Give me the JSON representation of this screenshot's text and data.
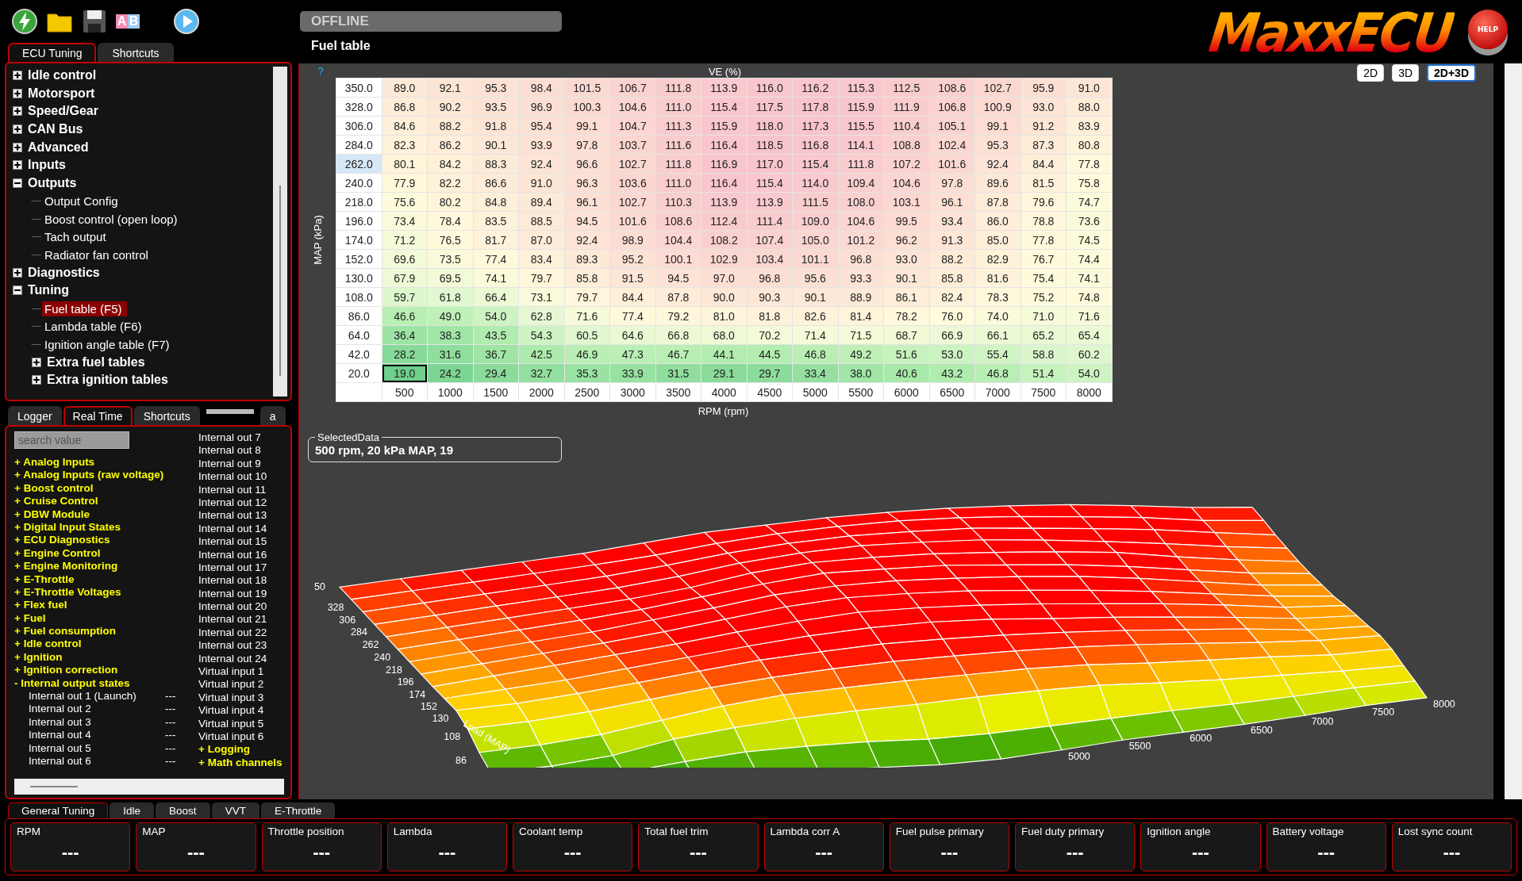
{
  "toolbar": [
    {
      "kind": "connect"
    },
    {
      "kind": "open"
    },
    {
      "kind": "save"
    },
    {
      "kind": "compare",
      "letters": [
        "A",
        "B"
      ]
    },
    {
      "kind": "play"
    }
  ],
  "status_field": {
    "value": "OFFLINE"
  },
  "page_title": "Fuel table",
  "logo": {
    "text": "MaxxECU"
  },
  "help_button": {
    "label": "HELP"
  },
  "tree_tabs": [
    {
      "label": "ECU Tuning",
      "selected": true
    },
    {
      "label": "Shortcuts",
      "selected": false
    }
  ],
  "tree": {
    "items": [
      {
        "label": "Idle control",
        "kind": "group",
        "expanded": false,
        "selected": false
      },
      {
        "label": "Motorsport",
        "kind": "group",
        "expanded": false,
        "selected": false
      },
      {
        "label": "Speed/Gear",
        "kind": "group",
        "expanded": false,
        "selected": false
      },
      {
        "label": "CAN Bus",
        "kind": "group",
        "expanded": false,
        "selected": false
      },
      {
        "label": "Advanced",
        "kind": "group",
        "expanded": false,
        "selected": false
      },
      {
        "label": "Inputs",
        "kind": "group",
        "expanded": false,
        "selected": false
      },
      {
        "label": "Outputs",
        "kind": "group",
        "expanded": true,
        "selected": false,
        "children": [
          {
            "label": "Output Config",
            "kind": "leaf",
            "selected": false
          },
          {
            "label": "Boost control (open loop)",
            "kind": "leaf",
            "selected": false
          },
          {
            "label": "Tach output",
            "kind": "leaf",
            "selected": false
          },
          {
            "label": "Radiator fan control",
            "kind": "leaf",
            "selected": false
          }
        ]
      },
      {
        "label": "Diagnostics",
        "kind": "group",
        "expanded": false,
        "selected": false
      },
      {
        "label": "Tuning",
        "kind": "group",
        "expanded": true,
        "selected": false,
        "children": [
          {
            "label": "Fuel table (F5)",
            "kind": "leaf",
            "selected": true
          },
          {
            "label": "Lambda table (F6)",
            "kind": "leaf",
            "selected": false
          },
          {
            "label": "Ignition angle table (F7)",
            "kind": "leaf",
            "selected": false
          },
          {
            "label": "Extra fuel tables",
            "kind": "group",
            "expanded": false,
            "selected": false
          },
          {
            "label": "Extra ignition tables",
            "kind": "group",
            "expanded": false,
            "selected": false
          }
        ]
      }
    ]
  },
  "logger_tabs": [
    {
      "label": "Logger",
      "selected": false
    },
    {
      "label": "Real Time",
      "selected": true
    },
    {
      "label": "Shortcuts",
      "selected": false
    },
    {
      "label": "a",
      "selected": false
    }
  ],
  "logger": {
    "search": {
      "placeholder": "search value"
    },
    "columns": [
      {
        "entries": [
          {
            "kind": "category",
            "toggle": "+",
            "label": "Analog Inputs"
          },
          {
            "kind": "category",
            "toggle": "+",
            "label": "Analog Inputs (raw voltage)"
          },
          {
            "kind": "category",
            "toggle": "+",
            "label": "Boost control"
          },
          {
            "kind": "category",
            "toggle": "+",
            "label": "Cruise Control"
          },
          {
            "kind": "category",
            "toggle": "+",
            "label": "DBW Module"
          },
          {
            "kind": "category",
            "toggle": "+",
            "label": "Digital Input States"
          },
          {
            "kind": "category",
            "toggle": "+",
            "label": "ECU Diagnostics"
          },
          {
            "kind": "category",
            "toggle": "+",
            "label": "Engine Control"
          },
          {
            "kind": "category",
            "toggle": "+",
            "label": "Engine Monitoring"
          },
          {
            "kind": "category",
            "toggle": "+",
            "label": "E-Throttle"
          },
          {
            "kind": "category",
            "toggle": "+",
            "label": "E-Throttle Voltages"
          },
          {
            "kind": "category",
            "toggle": "+",
            "label": "Flex fuel"
          },
          {
            "kind": "category",
            "toggle": "+",
            "label": "Fuel"
          },
          {
            "kind": "category",
            "toggle": "+",
            "label": "Fuel consumption"
          },
          {
            "kind": "category",
            "toggle": "+",
            "label": "Idle control"
          },
          {
            "kind": "category",
            "toggle": "+",
            "label": "Ignition"
          },
          {
            "kind": "category",
            "toggle": "+",
            "label": "Ignition correction"
          },
          {
            "kind": "category",
            "toggle": "-",
            "label": "Internal output states",
            "children": [
              {
                "name": "Internal out 1 (Launch)",
                "value": "---"
              },
              {
                "name": "Internal out 2",
                "value": "---"
              },
              {
                "name": "Internal out 3",
                "value": "---"
              },
              {
                "name": "Internal out 4",
                "value": "---"
              },
              {
                "name": "Internal out 5",
                "value": "---"
              },
              {
                "name": "Internal out 6",
                "value": "---"
              }
            ]
          }
        ]
      },
      {
        "entries": [
          {
            "kind": "channel",
            "name": "Internal out 7"
          },
          {
            "kind": "channel",
            "name": "Internal out 8"
          },
          {
            "kind": "channel",
            "name": "Internal out 9"
          },
          {
            "kind": "channel",
            "name": "Internal out 10"
          },
          {
            "kind": "channel",
            "name": "Internal out 11"
          },
          {
            "kind": "channel",
            "name": "Internal out 12"
          },
          {
            "kind": "channel",
            "name": "Internal out 13"
          },
          {
            "kind": "channel",
            "name": "Internal out 14"
          },
          {
            "kind": "channel",
            "name": "Internal out 15"
          },
          {
            "kind": "channel",
            "name": "Internal out 16"
          },
          {
            "kind": "channel",
            "name": "Internal out 17"
          },
          {
            "kind": "channel",
            "name": "Internal out 18"
          },
          {
            "kind": "channel",
            "name": "Internal out 19"
          },
          {
            "kind": "channel",
            "name": "Internal out 20"
          },
          {
            "kind": "channel",
            "name": "Internal out 21"
          },
          {
            "kind": "channel",
            "name": "Internal out 22"
          },
          {
            "kind": "channel",
            "name": "Internal out 23"
          },
          {
            "kind": "channel",
            "name": "Internal out 24"
          },
          {
            "kind": "channel",
            "name": "Virtual input 1"
          },
          {
            "kind": "channel",
            "name": "Virtual input 2"
          },
          {
            "kind": "channel",
            "name": "Virtual input 3"
          },
          {
            "kind": "channel",
            "name": "Virtual input 4"
          },
          {
            "kind": "channel",
            "name": "Virtual input 5"
          },
          {
            "kind": "channel",
            "name": "Virtual input 6"
          },
          {
            "kind": "category",
            "toggle": "+",
            "label": "Logging"
          },
          {
            "kind": "category",
            "toggle": "+",
            "label": "Math channels"
          }
        ]
      }
    ]
  },
  "view_buttons": [
    {
      "label": "2D",
      "selected": false
    },
    {
      "label": "3D",
      "selected": false
    },
    {
      "label": "2D+3D",
      "selected": true
    }
  ],
  "table": {
    "help": "?",
    "title": "VE (%)",
    "y_label": "MAP (kPa)",
    "x_label": "RPM (rpm)",
    "columns": [
      "500",
      "1000",
      "1500",
      "2000",
      "2500",
      "3000",
      "3500",
      "4000",
      "4500",
      "5000",
      "5500",
      "6000",
      "6500",
      "7000",
      "7500",
      "8000"
    ],
    "rows": [
      {
        "map": "350.0",
        "map_selected": false,
        "values": [
          "89.0",
          "92.1",
          "95.3",
          "98.4",
          "101.5",
          "106.7",
          "111.8",
          "113.9",
          "116.0",
          "116.2",
          "115.3",
          "112.5",
          "108.6",
          "102.7",
          "95.9",
          "91.0"
        ],
        "selected": [
          false,
          false,
          false,
          false,
          false,
          false,
          false,
          false,
          false,
          false,
          false,
          false,
          false,
          false,
          false,
          false
        ]
      },
      {
        "map": "328.0",
        "map_selected": false,
        "values": [
          "86.8",
          "90.2",
          "93.5",
          "96.9",
          "100.3",
          "104.6",
          "111.0",
          "115.4",
          "117.5",
          "117.8",
          "115.9",
          "111.9",
          "106.8",
          "100.9",
          "93.0",
          "88.0"
        ],
        "selected": [
          false,
          false,
          false,
          false,
          false,
          false,
          false,
          false,
          false,
          false,
          false,
          false,
          false,
          false,
          false,
          false
        ]
      },
      {
        "map": "306.0",
        "map_selected": false,
        "values": [
          "84.6",
          "88.2",
          "91.8",
          "95.4",
          "99.1",
          "104.7",
          "111.3",
          "115.9",
          "118.0",
          "117.3",
          "115.5",
          "110.4",
          "105.1",
          "99.1",
          "91.2",
          "83.9"
        ],
        "selected": [
          false,
          false,
          false,
          false,
          false,
          false,
          false,
          false,
          false,
          false,
          false,
          false,
          false,
          false,
          false,
          false
        ]
      },
      {
        "map": "284.0",
        "map_selected": false,
        "values": [
          "82.3",
          "86.2",
          "90.1",
          "93.9",
          "97.8",
          "103.7",
          "111.6",
          "116.4",
          "118.5",
          "116.8",
          "114.1",
          "108.8",
          "102.4",
          "95.3",
          "87.3",
          "80.8"
        ],
        "selected": [
          false,
          false,
          false,
          false,
          false,
          false,
          false,
          false,
          false,
          false,
          false,
          false,
          false,
          false,
          false,
          false
        ]
      },
      {
        "map": "262.0",
        "map_selected": true,
        "values": [
          "80.1",
          "84.2",
          "88.3",
          "92.4",
          "96.6",
          "102.7",
          "111.8",
          "116.9",
          "117.0",
          "115.4",
          "111.8",
          "107.2",
          "101.6",
          "92.4",
          "84.4",
          "77.8"
        ],
        "selected": [
          false,
          false,
          false,
          false,
          false,
          false,
          false,
          false,
          false,
          false,
          false,
          false,
          false,
          false,
          false,
          false
        ]
      },
      {
        "map": "240.0",
        "map_selected": false,
        "values": [
          "77.9",
          "82.2",
          "86.6",
          "91.0",
          "96.3",
          "103.6",
          "111.0",
          "116.4",
          "115.4",
          "114.0",
          "109.4",
          "104.6",
          "97.8",
          "89.6",
          "81.5",
          "75.8"
        ],
        "selected": [
          false,
          false,
          false,
          false,
          false,
          false,
          false,
          false,
          false,
          false,
          false,
          false,
          false,
          false,
          false,
          false
        ]
      },
      {
        "map": "218.0",
        "map_selected": false,
        "values": [
          "75.6",
          "80.2",
          "84.8",
          "89.4",
          "96.1",
          "102.7",
          "110.3",
          "113.9",
          "113.9",
          "111.5",
          "108.0",
          "103.1",
          "96.1",
          "87.8",
          "79.6",
          "74.7"
        ],
        "selected": [
          false,
          false,
          false,
          false,
          false,
          false,
          false,
          false,
          false,
          false,
          false,
          false,
          false,
          false,
          false,
          false
        ]
      },
      {
        "map": "196.0",
        "map_selected": false,
        "values": [
          "73.4",
          "78.4",
          "83.5",
          "88.5",
          "94.5",
          "101.6",
          "108.6",
          "112.4",
          "111.4",
          "109.0",
          "104.6",
          "99.5",
          "93.4",
          "86.0",
          "78.8",
          "73.6"
        ],
        "selected": [
          false,
          false,
          false,
          false,
          false,
          false,
          false,
          false,
          false,
          false,
          false,
          false,
          false,
          false,
          false,
          false
        ]
      },
      {
        "map": "174.0",
        "map_selected": false,
        "values": [
          "71.2",
          "76.5",
          "81.7",
          "87.0",
          "92.4",
          "98.9",
          "104.4",
          "108.2",
          "107.4",
          "105.0",
          "101.2",
          "96.2",
          "91.3",
          "85.0",
          "77.8",
          "74.5"
        ],
        "selected": [
          false,
          false,
          false,
          false,
          false,
          false,
          false,
          false,
          false,
          false,
          false,
          false,
          false,
          false,
          false,
          false
        ]
      },
      {
        "map": "152.0",
        "map_selected": false,
        "values": [
          "69.6",
          "73.5",
          "77.4",
          "83.4",
          "89.3",
          "95.2",
          "100.1",
          "102.9",
          "103.4",
          "101.1",
          "96.8",
          "93.0",
          "88.2",
          "82.9",
          "76.7",
          "74.4"
        ],
        "selected": [
          false,
          false,
          false,
          false,
          false,
          false,
          false,
          false,
          false,
          false,
          false,
          false,
          false,
          false,
          false,
          false
        ]
      },
      {
        "map": "130.0",
        "map_selected": false,
        "values": [
          "67.9",
          "69.5",
          "74.1",
          "79.7",
          "85.8",
          "91.5",
          "94.5",
          "97.0",
          "96.8",
          "95.6",
          "93.3",
          "90.1",
          "85.8",
          "81.6",
          "75.4",
          "74.1"
        ],
        "selected": [
          false,
          false,
          false,
          false,
          false,
          false,
          false,
          false,
          false,
          false,
          false,
          false,
          false,
          false,
          false,
          false
        ]
      },
      {
        "map": "108.0",
        "map_selected": false,
        "values": [
          "59.7",
          "61.8",
          "66.4",
          "73.1",
          "79.7",
          "84.4",
          "87.8",
          "90.0",
          "90.3",
          "90.1",
          "88.9",
          "86.1",
          "82.4",
          "78.3",
          "75.2",
          "74.8"
        ],
        "selected": [
          false,
          false,
          false,
          false,
          false,
          false,
          false,
          false,
          false,
          false,
          false,
          false,
          false,
          false,
          false,
          false
        ]
      },
      {
        "map": "86.0",
        "map_selected": false,
        "values": [
          "46.6",
          "49.0",
          "54.0",
          "62.8",
          "71.6",
          "77.4",
          "79.2",
          "81.0",
          "81.8",
          "82.6",
          "81.4",
          "78.2",
          "76.0",
          "74.0",
          "71.0",
          "71.6"
        ],
        "selected": [
          false,
          false,
          false,
          false,
          false,
          false,
          false,
          false,
          false,
          false,
          false,
          false,
          false,
          false,
          false,
          false
        ]
      },
      {
        "map": "64.0",
        "map_selected": false,
        "values": [
          "36.4",
          "38.3",
          "43.5",
          "54.3",
          "60.5",
          "64.6",
          "66.8",
          "68.0",
          "70.2",
          "71.4",
          "71.5",
          "68.7",
          "66.9",
          "66.1",
          "65.2",
          "65.4"
        ],
        "selected": [
          false,
          false,
          false,
          false,
          false,
          false,
          false,
          false,
          false,
          false,
          false,
          false,
          false,
          false,
          false,
          false
        ]
      },
      {
        "map": "42.0",
        "map_selected": false,
        "values": [
          "28.2",
          "31.6",
          "36.7",
          "42.5",
          "46.9",
          "47.3",
          "46.7",
          "44.1",
          "44.5",
          "46.8",
          "49.2",
          "51.6",
          "53.0",
          "55.4",
          "58.8",
          "60.2"
        ],
        "selected": [
          false,
          false,
          false,
          false,
          false,
          false,
          false,
          false,
          false,
          false,
          false,
          false,
          false,
          false,
          false,
          false
        ]
      },
      {
        "map": "20.0",
        "map_selected": false,
        "values": [
          "19.0",
          "24.2",
          "29.4",
          "32.7",
          "35.3",
          "33.9",
          "31.5",
          "29.1",
          "29.7",
          "33.4",
          "38.0",
          "40.6",
          "43.2",
          "46.8",
          "51.4",
          "54.0"
        ],
        "selected": [
          true,
          false,
          false,
          false,
          false,
          false,
          false,
          false,
          false,
          false,
          false,
          false,
          false,
          false,
          false,
          false
        ]
      }
    ]
  },
  "selected_data": {
    "legend": "SelectedData",
    "value": "500 rpm, 20 kPa MAP, 19"
  },
  "plot3d": {
    "z_label": "50",
    "load_labels": [
      "328",
      "306",
      "284",
      "262",
      "240",
      "218",
      "196",
      "174",
      "152",
      "130",
      "108",
      "86"
    ],
    "load_title": "Load (MAP)",
    "rpm_labels": [
      "8000",
      "7500",
      "7000",
      "6500",
      "6000",
      "5500",
      "5000"
    ]
  },
  "bottom_tabs": [
    {
      "label": "General Tuning",
      "selected": true
    },
    {
      "label": "Idle",
      "selected": false
    },
    {
      "label": "Boost",
      "selected": false
    },
    {
      "label": "VVT",
      "selected": false
    },
    {
      "label": "E-Throttle",
      "selected": false
    }
  ],
  "gauges": [
    {
      "label": "RPM",
      "value": "---"
    },
    {
      "label": "MAP",
      "value": "---"
    },
    {
      "label": "Throttle position",
      "value": "---"
    },
    {
      "label": "Lambda",
      "value": "---"
    },
    {
      "label": "Coolant temp",
      "value": "---"
    },
    {
      "label": "Total fuel trim",
      "value": "---"
    },
    {
      "label": "Lambda corr A",
      "value": "---"
    },
    {
      "label": "Fuel pulse primary",
      "value": "---"
    },
    {
      "label": "Fuel duty primary",
      "value": "---"
    },
    {
      "label": "Ignition angle",
      "value": "---"
    },
    {
      "label": "Battery voltage",
      "value": "---"
    },
    {
      "label": "Lost sync count",
      "value": "---"
    }
  ]
}
